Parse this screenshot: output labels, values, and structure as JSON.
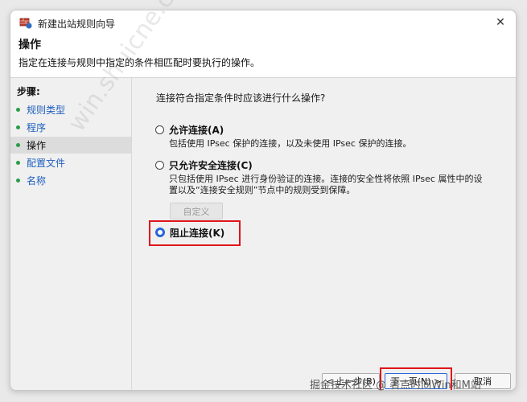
{
  "window": {
    "title": "新建出站规则向导",
    "close_symbol": "✕",
    "app_icon": "firewall-shield-icon"
  },
  "header": {
    "title": "操作",
    "description": "指定在连接与规则中指定的条件相匹配时要执行的操作。"
  },
  "steps": {
    "heading": "步骤:",
    "items": [
      {
        "label": "规则类型",
        "active": false
      },
      {
        "label": "程序",
        "active": false
      },
      {
        "label": "操作",
        "active": true
      },
      {
        "label": "配置文件",
        "active": false
      },
      {
        "label": "名称",
        "active": false
      }
    ]
  },
  "main": {
    "question": "连接符合指定条件时应该进行什么操作?",
    "options": [
      {
        "label": "允许连接(A)",
        "selected": false,
        "desc": [
          "包括使用 IPsec 保护的连接，以及未使用 IPsec 保护的连接。"
        ]
      },
      {
        "label": "只允许安全连接(C)",
        "selected": false,
        "desc": [
          "只包括使用 IPsec 进行身份验证的连接。连接的安全性将依照 IPsec 属性中的设",
          "置以及“连接安全规则”节点中的规则受到保障。"
        ]
      },
      {
        "label": "阻止连接(K)",
        "selected": true,
        "desc": []
      }
    ],
    "customize_label": "自定义"
  },
  "buttons": {
    "back": "< 上一步(B)",
    "next": "下一页(N) >",
    "cancel": "取消"
  },
  "overlay": {
    "watermark": "win.shuicne.cc",
    "credit": "掘金技术社区 @ 著点时间Win和M站"
  },
  "colors": {
    "accent": "#2766d8",
    "highlight": "#e0141a",
    "step_bullet": "#2a9d4a",
    "link": "#1f5fbf"
  }
}
